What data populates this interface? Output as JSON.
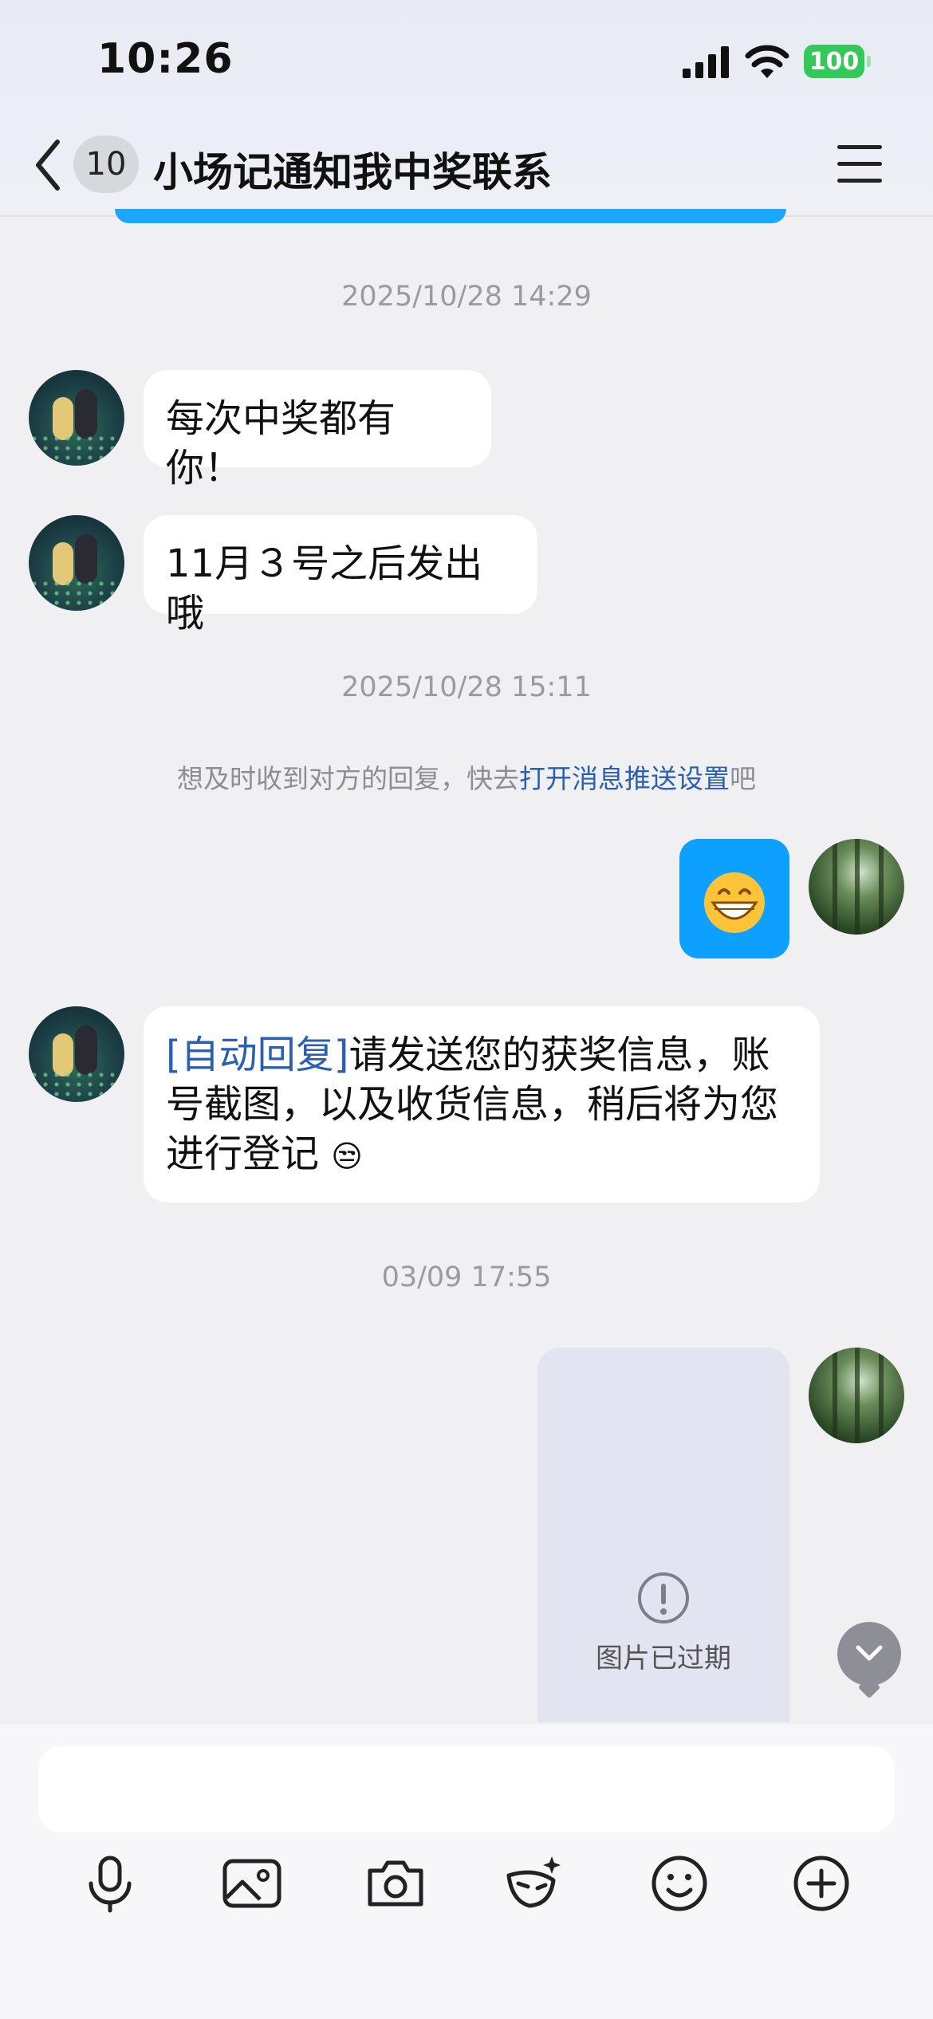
{
  "status_bar": {
    "time": "10:26",
    "battery": "100"
  },
  "header": {
    "unread_count": "10",
    "title": "小场记通知我中奖联系"
  },
  "messages": {
    "ts1": "2025/10/28 14:29",
    "m1": "每次中奖都有你！",
    "m2": "11月３号之后发出哦",
    "ts2": "2025/10/28 15:11",
    "notice_prefix": "想及时收到对方的回复，快去",
    "notice_link": "打开消息推送设置",
    "notice_suffix": "吧",
    "m3_emoji": "😁",
    "m4_tag": "[自动回复]",
    "m4_text": "请发送您的获奖信息，账号截图，以及收货信息，稍后将为您进行登记",
    "m4_emoji": "😒",
    "ts3": "03/09 17:55",
    "expired_image": "图片已过期"
  },
  "input": {
    "placeholder": ""
  },
  "toolbar_icons": [
    "microphone-icon",
    "image-icon",
    "camera-icon",
    "ai-mask-icon",
    "smiley-icon",
    "plus-icon"
  ],
  "colors": {
    "accent": "#0ea0ff",
    "link": "#2b5fb0",
    "battery": "#34c759"
  }
}
